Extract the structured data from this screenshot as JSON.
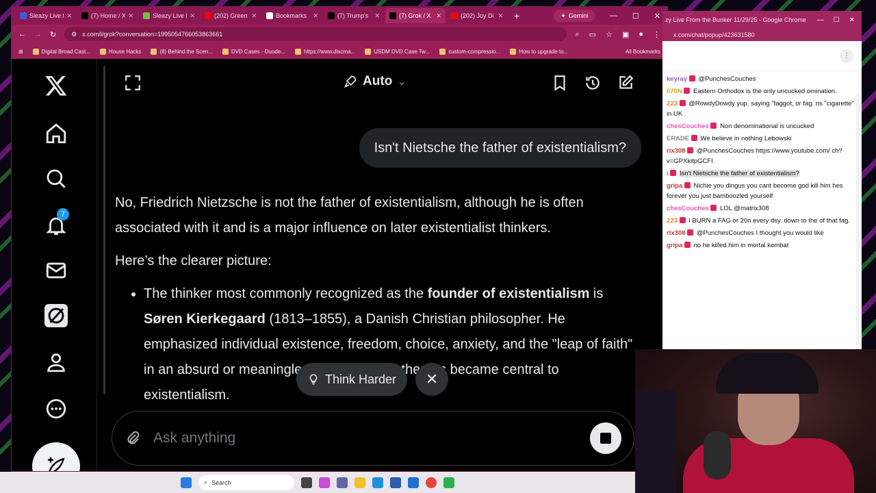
{
  "main_browser": {
    "tabs": [
      {
        "label": "Sleazy Live f",
        "icon": "sleazy-favicon",
        "color": "#3b5bdb"
      },
      {
        "label": "(7) Home / X",
        "icon": "x-favicon",
        "color": "#000000"
      },
      {
        "label": "Sleazy Live F",
        "icon": "rumble-favicon",
        "color": "#74c043"
      },
      {
        "label": "(202) Green",
        "icon": "youtube-favicon",
        "color": "#ff0000"
      },
      {
        "label": "Bookmarks",
        "icon": "star-favicon",
        "color": "#ffffff"
      },
      {
        "label": "(7) Trump's",
        "icon": "x-favicon",
        "color": "#000000"
      },
      {
        "label": "(7) Grok / X",
        "icon": "x-favicon",
        "color": "#000000"
      },
      {
        "label": "(202) Joy Di",
        "icon": "youtube-favicon",
        "color": "#ff0000"
      }
    ],
    "gemini_label": "Gemini",
    "url": "x.com/i/grok?conversation=1995054766053863661",
    "bookmarks": [
      "Digital Broad Cast...",
      "House Hacks",
      "(8) Behind the Scen...",
      "DVD Cases - Duode...",
      "https://www.discma...",
      "USDM DVD Case Tw...",
      "custom-compressio...",
      "How to upgrade to..."
    ],
    "all_bookmarks": "All Bookmarks"
  },
  "x_nav": {
    "notification_count": "7"
  },
  "grok": {
    "model_label": "Auto",
    "user_message": "Isn't Nietsche the father of existentialism?",
    "answer": {
      "p1": "No, Friedrich Nietzsche is not the father of existentialism, although he is often associated with it and is a major influence on later existentialist thinkers.",
      "p2": "Here’s the clearer picture:",
      "li1_pre": "The thinker most commonly recognized as the ",
      "li1_bold1": "founder of existentialism",
      "li1_mid": " is ",
      "li1_bold2": "Søren Kierkegaard",
      "li1_post": " (1813–1855), a Danish Christian philosopher. He emphasized individual existence, freedom, choice, anxiety, and the \"leap of faith\" in an absurd or meaningless world. These themes became central to existentialism."
    },
    "think_harder_label": "Think Harder",
    "composer_placeholder": "Ask anything"
  },
  "chat_popup": {
    "title": "zy Live From the Bunker 11/29/25 - Google Chrome",
    "url": "x.com/chat/popup/423631580",
    "messages": [
      {
        "user": "keyray",
        "text": "@PunchesCouches",
        "user_color": "#9b59b6"
      },
      {
        "user": "070N",
        "text": "Eastern Orthodox is the only uncucked omination.",
        "user_color": "#d4a017"
      },
      {
        "user": "223",
        "text": "@RowdyDowdy yup. saying \"faggot, or fag. ns \"cigarette\" in UK",
        "user_color": "#e67e22"
      },
      {
        "user": "chesCouches",
        "text": "Non denominational is uncucked",
        "user_color": "#e056b9"
      },
      {
        "user": "ERADE",
        "text": "We believe in nothing Lebowski",
        "user_color": "#888888"
      },
      {
        "user": "rix308",
        "text": "@PunchesCouches https://www.youtube.com/ ch?v=GPXkitpGCFI",
        "user_color": "#c0392b"
      },
      {
        "user": "i",
        "text": "Isn't Nietsche the father of existentialism?",
        "user_color": "#e056b9"
      },
      {
        "user": "gripa",
        "text": "Nichie you dingus you cant become god kill him hes forever you just bamboozled yourself",
        "user_color": "#c0392b"
      },
      {
        "user": "chesCouches",
        "text": "LOL @matrix308",
        "user_color": "#e056b9"
      },
      {
        "user": "223",
        "text": "I BURN a FAG or 20n every dsy. down to the of that fag.",
        "user_color": "#e67e22"
      },
      {
        "user": "rix308",
        "text": "@PunchesCouches I thought you would like",
        "user_color": "#c0392b"
      },
      {
        "user": "gripa",
        "text": "no he killed him in mortal kombat",
        "user_color": "#c0392b"
      }
    ]
  },
  "taskbar": {
    "search_label": "Search"
  }
}
